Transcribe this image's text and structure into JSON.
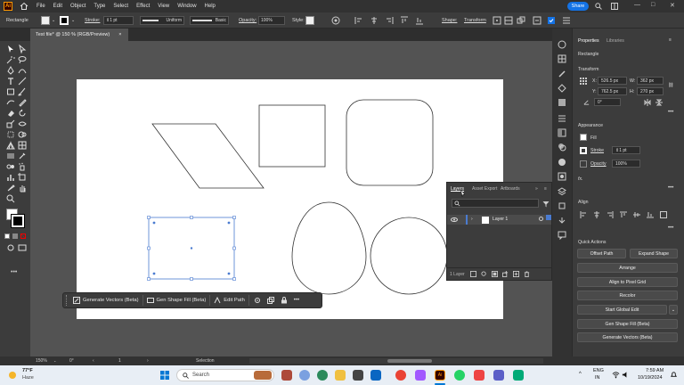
{
  "menubar": {
    "app_logo": "Ai",
    "items": [
      "File",
      "Edit",
      "Object",
      "Type",
      "Select",
      "Effect",
      "View",
      "Window",
      "Help"
    ],
    "share_label": "Share"
  },
  "controlbar": {
    "selection_type": "Rectangle",
    "stroke_label": "Stroke:",
    "stroke_value": "1 pt",
    "profile_label": "Uniform",
    "brush_label": "Basic",
    "opacity_label": "Opacity:",
    "opacity_value": "100%",
    "style_label": "Style:",
    "shape_label": "Shape:",
    "transform_label": "Transform"
  },
  "document_tab": {
    "title": "Test file* @ 150 % (RGB/Preview)",
    "close": "×"
  },
  "context_bar": {
    "generate_vectors": "Generate Vectors (Beta)",
    "gen_shape_fill": "Gen Shape Fill (Beta)",
    "edit_path": "Edit Path",
    "more": "•••"
  },
  "layers_panel": {
    "tabs": [
      "Layers",
      "Asset Export",
      "Artboards"
    ],
    "layer_name": "Layer 1",
    "footer_count": "1 Layer"
  },
  "statusbar": {
    "zoom": "150%",
    "rotation": "0°",
    "artboard_num": "1",
    "mode": "Selection"
  },
  "properties": {
    "tabs": [
      "Properties",
      "Libraries"
    ],
    "object_type": "Rectangle",
    "transform_title": "Transform",
    "x_label": "X:",
    "x_value": "526.5 px",
    "y_label": "Y:",
    "y_value": "762.5 px",
    "w_label": "W:",
    "w_value": "362 px",
    "h_label": "H:",
    "h_value": "270 px",
    "angle_value": "0°",
    "appearance_title": "Appearance",
    "fill_label": "Fill",
    "stroke_label": "Stroke",
    "stroke_value": "1 pt",
    "opacity_label": "Opacity",
    "opacity_value": "100%",
    "fx_label": "fx.",
    "align_title": "Align",
    "quick_actions_title": "Quick Actions",
    "offset_path": "Offset Path",
    "expand_shape": "Expand Shape",
    "arrange": "Arrange",
    "align_pixel_grid": "Align to Pixel Grid",
    "recolor": "Recolor",
    "start_global_edit": "Start Global Edit",
    "gen_shape_fill": "Gen Shape Fill (Beta)",
    "generate_vectors": "Generate Vectors (Beta)"
  },
  "taskbar": {
    "weather_temp": "77°F",
    "weather_desc": "Haze",
    "search_placeholder": "Search",
    "lang_top": "ENG",
    "lang_bottom": "IN",
    "time": "7:59 AM",
    "date": "10/19/2024"
  },
  "colors": {
    "accent": "#1473e6",
    "selection": "#4a7bd0",
    "app_orange": "#ff9a00"
  }
}
